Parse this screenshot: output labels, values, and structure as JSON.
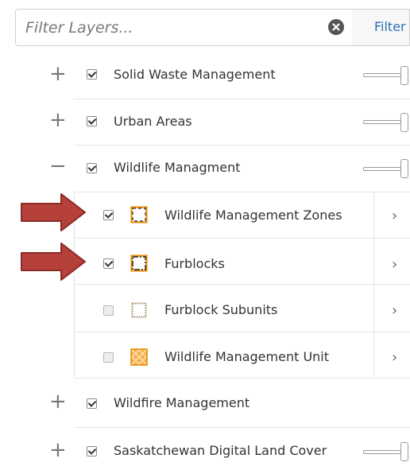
{
  "filter": {
    "placeholder": "Filter Layers...",
    "button_label": "Filter",
    "clear_icon": "clear-circle-x-icon"
  },
  "layers": [
    {
      "label": "Solid Waste Management",
      "expanded": false,
      "checked": true,
      "expander": "+",
      "has_slider": true
    },
    {
      "label": "Urban Areas",
      "expanded": false,
      "checked": true,
      "expander": "+",
      "has_slider": true
    },
    {
      "label": "Wildlife Managment",
      "expanded": true,
      "checked": true,
      "expander": "−",
      "has_slider": true
    },
    {
      "label": "Wildfire Management",
      "expanded": false,
      "checked": true,
      "expander": "+",
      "has_slider": false
    },
    {
      "label": "Saskatchewan Digital Land Cover",
      "expanded": false,
      "checked": true,
      "expander": "+",
      "has_slider": true
    }
  ],
  "sublayers": [
    {
      "label": "Wildlife Management Zones",
      "checked": true,
      "icon": "dashed-outline-orange-icon",
      "highlighted": true
    },
    {
      "label": "Furblocks",
      "checked": true,
      "icon": "dashdot-outline-orange-icon",
      "highlighted": true
    },
    {
      "label": "Furblock Subunits",
      "checked": false,
      "icon": "dotted-outline-tan-icon",
      "highlighted": false
    },
    {
      "label": "Wildlife Management Unit",
      "checked": false,
      "icon": "crosshatch-orange-icon",
      "highlighted": false
    }
  ],
  "chevron": "›",
  "colors": {
    "arrow": "#b5413a",
    "arrow_stroke": "#8b2b26",
    "icon_orange": "#e58a00",
    "link_blue": "#2a6fb3"
  }
}
